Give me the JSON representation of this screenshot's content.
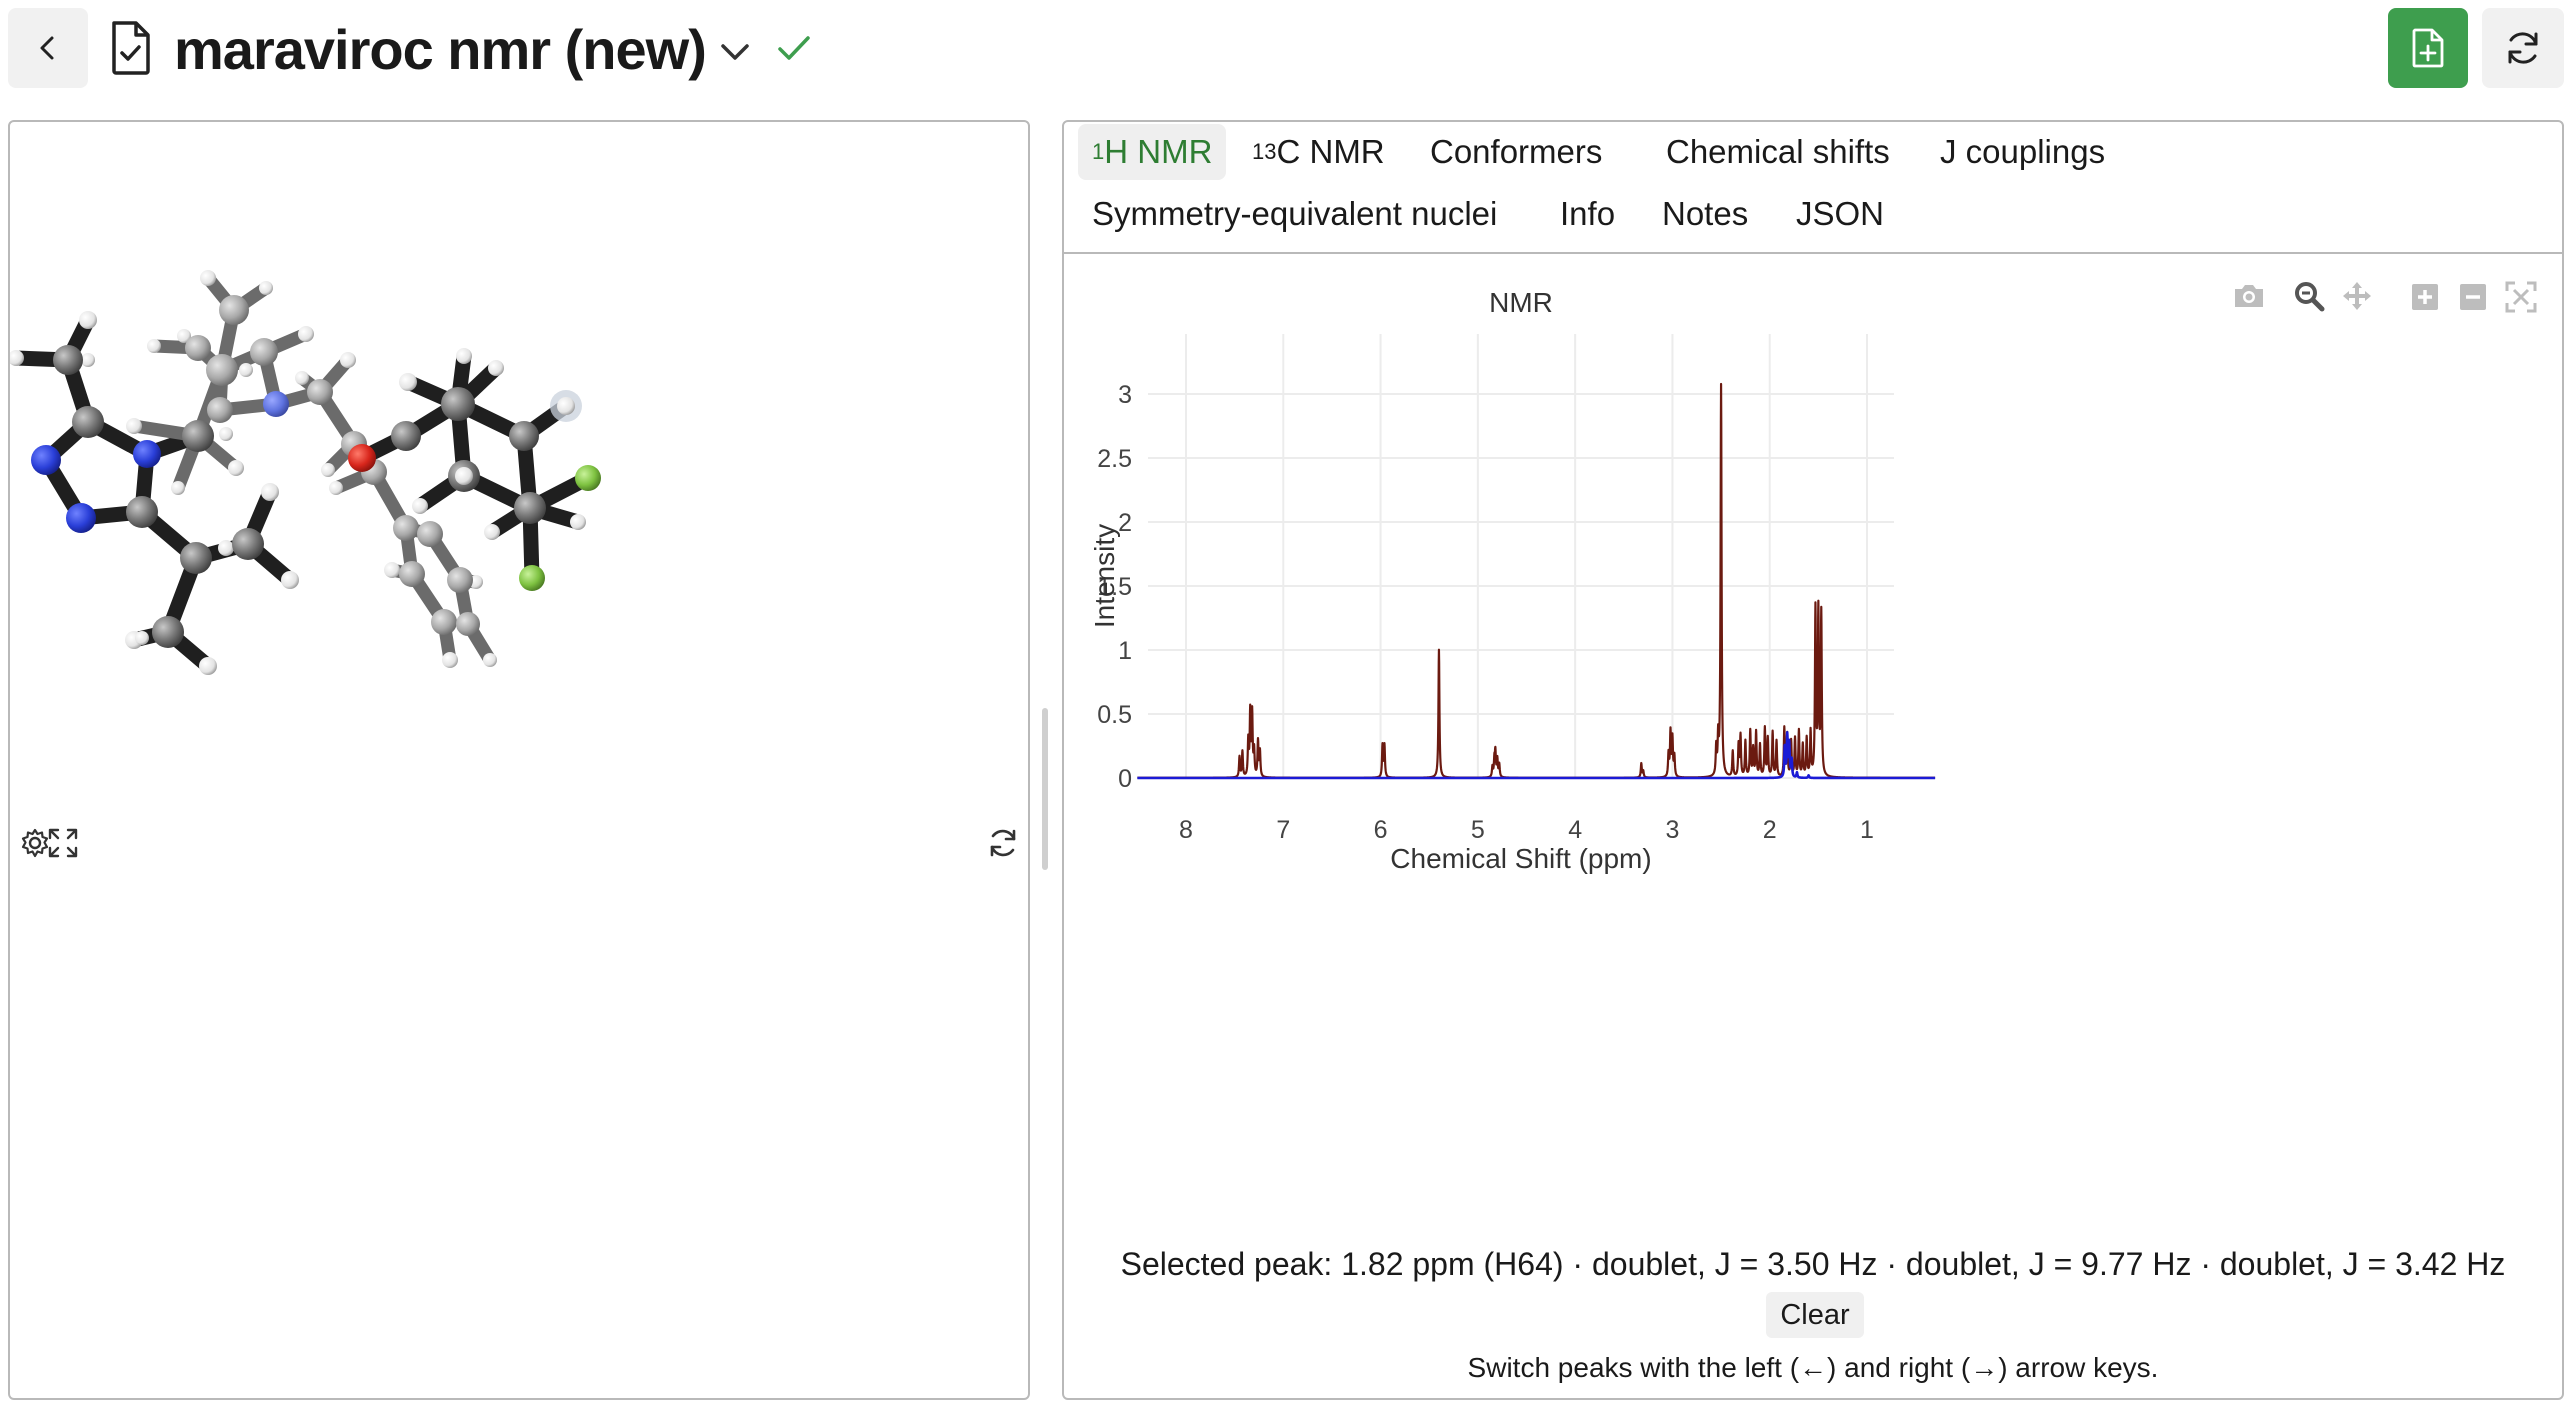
{
  "header": {
    "title": "maraviroc nmr (new)",
    "back_icon": "chevron-left-icon",
    "doc_icon": "document-check-icon",
    "status_icon": "check-icon",
    "new_button_icon": "file-plus-icon",
    "refresh_icon": "refresh-icon",
    "accent_color": "#3e9e4e"
  },
  "tabs": [
    {
      "sup": "1",
      "label": "H NMR",
      "active": true
    },
    {
      "sup": "13",
      "label": "C NMR",
      "active": false
    },
    {
      "sup": "",
      "label": "Conformers",
      "active": false
    },
    {
      "sup": "",
      "label": "Chemical shifts",
      "active": false
    },
    {
      "sup": "",
      "label": "J couplings",
      "active": false
    },
    {
      "sup": "",
      "label": "Symmetry-equivalent nuclei",
      "active": false
    },
    {
      "sup": "",
      "label": "Info",
      "active": false
    },
    {
      "sup": "",
      "label": "Notes",
      "active": false
    },
    {
      "sup": "",
      "label": "JSON",
      "active": false
    }
  ],
  "viewer": {
    "controls": [
      "gear-icon",
      "expand-icon",
      "rotate-icon"
    ],
    "atom_colors": {
      "C": "#6e6e6e",
      "H": "#e8e8e8",
      "N": "#2f45d6",
      "O": "#d92a22",
      "F": "#7ec241"
    }
  },
  "chart_data": {
    "type": "line",
    "title": "NMR",
    "xlabel": "Chemical Shift (ppm)",
    "ylabel": "Intensity",
    "xlim": [
      8.5,
      0.3
    ],
    "ylim": [
      -0.05,
      3.3
    ],
    "xticks": [
      8,
      7,
      6,
      5,
      4,
      3,
      2,
      1
    ],
    "yticks": [
      0,
      0.5,
      1,
      1.5,
      2,
      2.5,
      3
    ],
    "ytick_labels": [
      "0",
      "0.5",
      "1",
      "1.5",
      "2",
      "2.5",
      "3"
    ],
    "grid": true,
    "series": [
      {
        "color": "#6b1a10",
        "peaks": [
          [
            7.45,
            0.16
          ],
          [
            7.42,
            0.2
          ],
          [
            7.36,
            0.28
          ],
          [
            7.34,
            0.5
          ],
          [
            7.32,
            0.49
          ],
          [
            7.3,
            0.2
          ],
          [
            7.26,
            0.28
          ],
          [
            7.24,
            0.2
          ],
          [
            5.98,
            0.25
          ],
          [
            5.96,
            0.25
          ],
          [
            5.4,
            1.0
          ],
          [
            4.85,
            0.08
          ],
          [
            4.83,
            0.13
          ],
          [
            4.82,
            0.19
          ],
          [
            4.8,
            0.14
          ],
          [
            4.78,
            0.1
          ],
          [
            3.32,
            0.11
          ],
          [
            3.3,
            0.05
          ],
          [
            3.04,
            0.18
          ],
          [
            3.02,
            0.35
          ],
          [
            3.0,
            0.3
          ],
          [
            2.98,
            0.16
          ],
          [
            2.55,
            0.22
          ],
          [
            2.53,
            0.28
          ],
          [
            2.5,
            3.06
          ],
          [
            2.38,
            0.2
          ],
          [
            2.32,
            0.25
          ],
          [
            2.3,
            0.32
          ],
          [
            2.25,
            0.28
          ],
          [
            2.2,
            0.36
          ],
          [
            2.17,
            0.22
          ],
          [
            2.14,
            0.35
          ],
          [
            2.1,
            0.25
          ],
          [
            2.05,
            0.38
          ],
          [
            2.02,
            0.3
          ],
          [
            1.97,
            0.35
          ],
          [
            1.93,
            0.28
          ],
          [
            1.85,
            0.38
          ],
          [
            1.82,
            0.33
          ],
          [
            1.78,
            0.28
          ],
          [
            1.74,
            0.3
          ],
          [
            1.7,
            0.36
          ],
          [
            1.66,
            0.25
          ],
          [
            1.62,
            0.3
          ],
          [
            1.58,
            0.35
          ],
          [
            1.53,
            1.3
          ],
          [
            1.5,
            1.28
          ],
          [
            1.47,
            1.27
          ]
        ]
      },
      {
        "color": "#1b1bd6",
        "peaks": [
          [
            1.845,
            0.24
          ],
          [
            1.82,
            0.32
          ],
          [
            1.8,
            0.26
          ],
          [
            1.775,
            0.14
          ],
          [
            1.72,
            0.04
          ],
          [
            1.6,
            0.02
          ]
        ]
      }
    ],
    "selected_peak": {
      "shift_ppm": 1.82,
      "atom": "H64"
    }
  },
  "plot_tools": [
    "camera-icon",
    "zoom-icon",
    "pan-icon",
    "zoom-in-icon",
    "zoom-out-icon",
    "autoscale-icon"
  ],
  "selection": {
    "text": "Selected peak: 1.82 ppm (H64) · doublet, J = 3.50 Hz · doublet, J = 9.77 Hz · doublet, J = 3.42 Hz",
    "clear_label": "Clear",
    "hint": "Switch peaks with the left (←) and right (→) arrow keys."
  }
}
